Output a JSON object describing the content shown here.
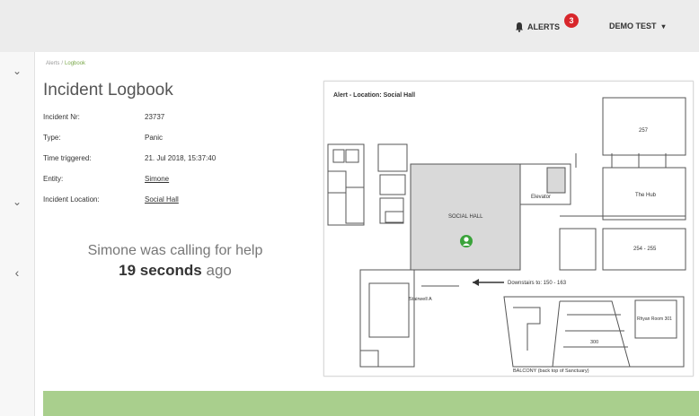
{
  "header": {
    "alerts_label": "ALERTS",
    "alerts_count": "3",
    "user_name": "DEMO TEST",
    "user_caret": "▾"
  },
  "rail": {
    "top_chevron": "⌄",
    "mid_chevron": "⌄",
    "back_chevron": "‹"
  },
  "breadcrumb": {
    "root": "Alerts",
    "sep": "/",
    "current": "Logbook"
  },
  "page": {
    "title": "Incident Logbook"
  },
  "incident": {
    "fields": [
      {
        "label": "Incident Nr:",
        "value": "23737"
      },
      {
        "label": "Type:",
        "value": "Panic"
      },
      {
        "label": "Time triggered:",
        "value": "21. Jul 2018, 15:37:40"
      },
      {
        "label": "Entity:",
        "value": "Simone"
      },
      {
        "label": "Incident Location:",
        "value": "Social Hall"
      }
    ]
  },
  "calling": {
    "line1": "Simone was calling for help",
    "duration": "19 seconds",
    "suffix": "ago"
  },
  "map": {
    "title": "Alert - Location: Social Hall",
    "rooms": {
      "social_hall": "SOCIAL HALL",
      "elevator": "Elevator",
      "the_hub": "The Hub",
      "room_257": "257",
      "room_254": "254 - 255",
      "downstairs": "Downstairs to: 150 - 163",
      "stairwell": "Stairwell A",
      "balcony": "BALCONY (back top of Sanctuary)",
      "room_300": "300",
      "room_301": "Rhyan Room 301"
    },
    "marker_color": "#3aa33a"
  },
  "status": {
    "color": "#a9cf8d"
  }
}
